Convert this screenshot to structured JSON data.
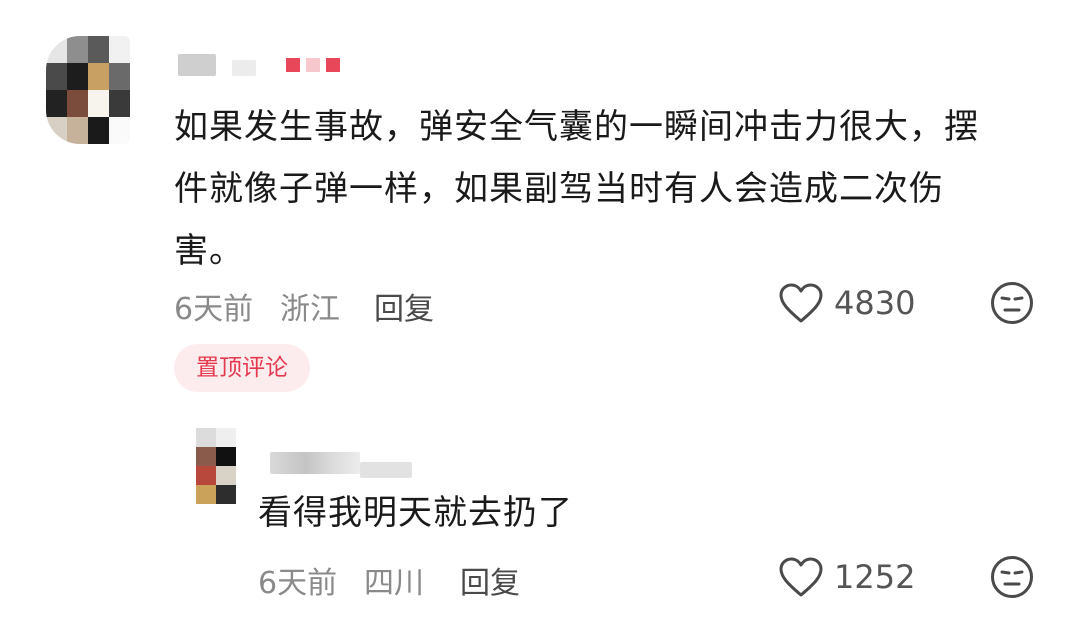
{
  "main_comment": {
    "text_lines": [
      "如果发生事故，弹安全气囊的一瞬间冲击力很大，摆",
      "件就像子弹一样，如果副驾当时有人会造成二次伤",
      "害。"
    ],
    "time": "6天前",
    "location": "浙江",
    "reply_label": "回复",
    "like_count": "4830",
    "pin_badge": "置顶评论"
  },
  "reply_comment": {
    "text": "看得我明天就去扔了",
    "time": "6天前",
    "location": "四川",
    "reply_label": "回复",
    "like_count": "1252"
  },
  "icons": {
    "like": "heart-outline-icon",
    "dislike": "neutral-face-icon"
  },
  "colors": {
    "pin_badge_text": "#e4394f",
    "pin_badge_bg": "#fdecee",
    "meta_text": "#8a8a8a"
  }
}
